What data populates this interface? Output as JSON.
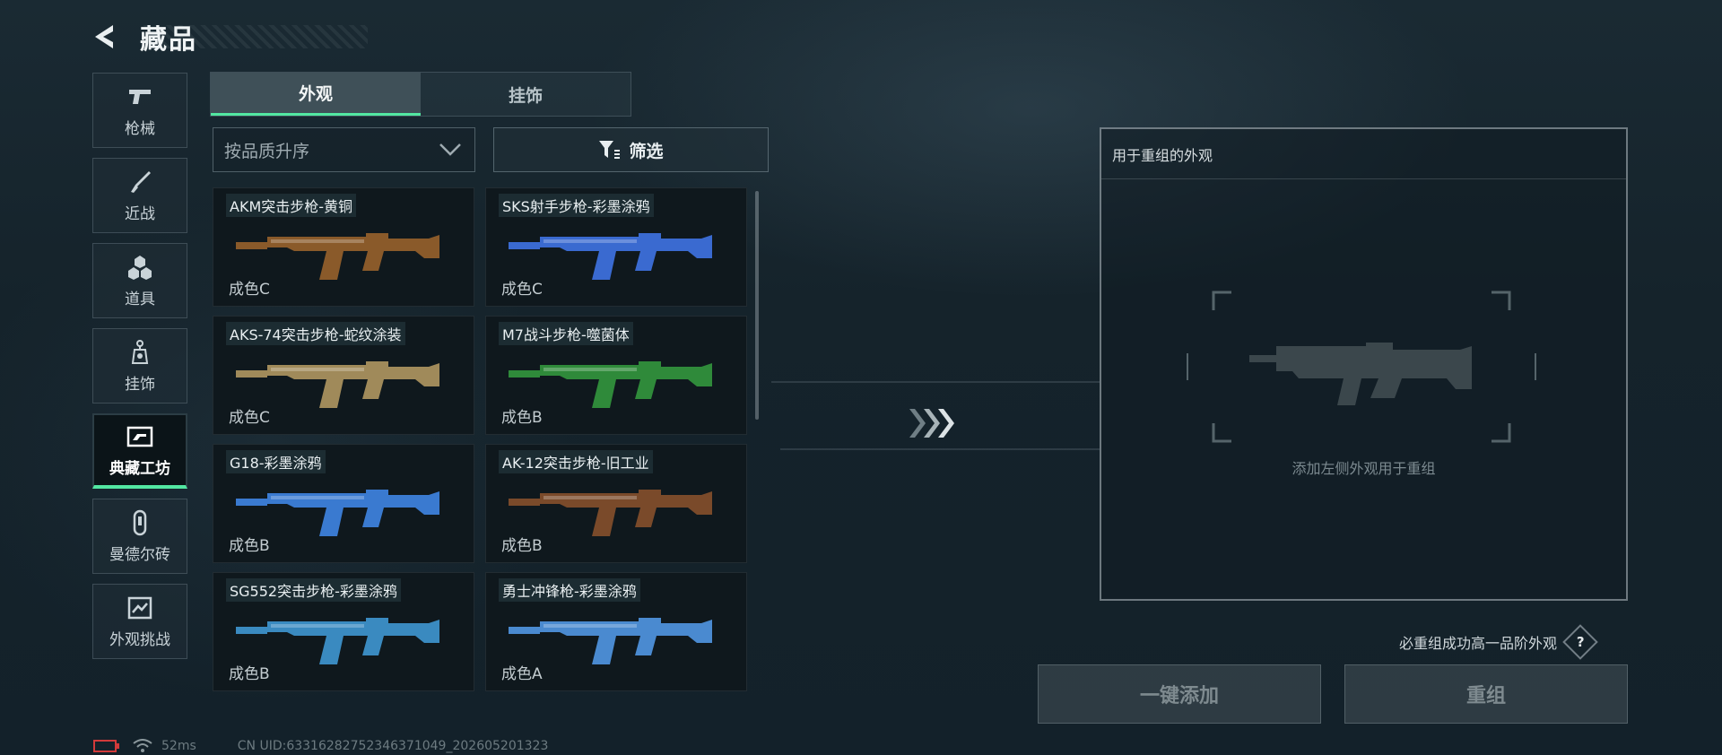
{
  "header": {
    "title": "藏品"
  },
  "sidebar": {
    "items": [
      {
        "label": "枪械",
        "icon": "pistol-icon"
      },
      {
        "label": "近战",
        "icon": "knife-icon"
      },
      {
        "label": "道具",
        "icon": "grenades-icon"
      },
      {
        "label": "挂饰",
        "icon": "charm-icon"
      },
      {
        "label": "典藏工坊",
        "icon": "workshop-icon",
        "active": true
      },
      {
        "label": "曼德尔砖",
        "icon": "brick-icon"
      },
      {
        "label": "外观挑战",
        "icon": "challenge-icon"
      }
    ]
  },
  "tabs": [
    {
      "label": "外观",
      "active": true
    },
    {
      "label": "挂饰",
      "active": false
    }
  ],
  "sort": {
    "value": "按品质升序"
  },
  "filter": {
    "label": "筛选"
  },
  "cards": [
    {
      "name": "AKM突击步枪-黄铜",
      "grade": "成色C",
      "color": "#8a5a2a"
    },
    {
      "name": "SKS射手步枪-彩墨涂鸦",
      "grade": "成色C",
      "color": "#3a6ad0"
    },
    {
      "name": "AKS-74突击步枪-蛇纹涂装",
      "grade": "成色C",
      "color": "#a08a5a"
    },
    {
      "name": "M7战斗步枪-噬菌体",
      "grade": "成色B",
      "color": "#2f8a3a"
    },
    {
      "name": "G18-彩墨涂鸦",
      "grade": "成色B",
      "color": "#3a7ad0"
    },
    {
      "name": "AK-12突击步枪-旧工业",
      "grade": "成色B",
      "color": "#7a4a2a"
    },
    {
      "name": "SG552突击步枪-彩墨涂鸦",
      "grade": "成色B",
      "color": "#3a8ac0"
    },
    {
      "name": "勇士冲锋枪-彩墨涂鸦",
      "grade": "成色A",
      "color": "#4a8ad0"
    }
  ],
  "panel": {
    "title": "用于重组的外观",
    "hint": "添加左侧外观用于重组"
  },
  "guarantee": {
    "text": "必重组成功高一品阶外观",
    "help": "?"
  },
  "buttons": {
    "add_all": "一键添加",
    "recombine": "重组"
  },
  "status": {
    "ping": "52ms",
    "uid": "CN UID:63316282752346371049_202605201323"
  }
}
